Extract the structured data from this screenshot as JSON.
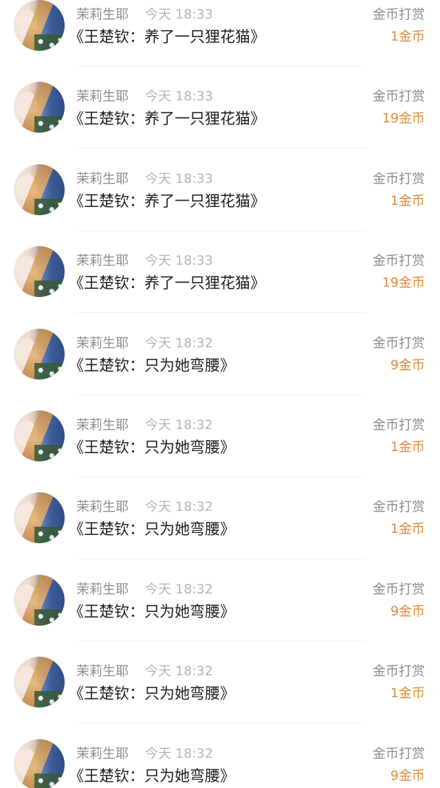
{
  "items": [
    {
      "user": "茉莉生耶",
      "time": "今天 18:33",
      "book": "《王楚钦：养了一只狸花猫》",
      "reward_label": "金币打赏",
      "amount": "1金币"
    },
    {
      "user": "茉莉生耶",
      "time": "今天 18:33",
      "book": "《王楚钦：养了一只狸花猫》",
      "reward_label": "金币打赏",
      "amount": "19金币"
    },
    {
      "user": "茉莉生耶",
      "time": "今天 18:33",
      "book": "《王楚钦：养了一只狸花猫》",
      "reward_label": "金币打赏",
      "amount": "1金币"
    },
    {
      "user": "茉莉生耶",
      "time": "今天 18:33",
      "book": "《王楚钦：养了一只狸花猫》",
      "reward_label": "金币打赏",
      "amount": "19金币"
    },
    {
      "user": "茉莉生耶",
      "time": "今天 18:32",
      "book": "《王楚钦：只为她弯腰》",
      "reward_label": "金币打赏",
      "amount": "9金币"
    },
    {
      "user": "茉莉生耶",
      "time": "今天 18:32",
      "book": "《王楚钦：只为她弯腰》",
      "reward_label": "金币打赏",
      "amount": "1金币"
    },
    {
      "user": "茉莉生耶",
      "time": "今天 18:32",
      "book": "《王楚钦：只为她弯腰》",
      "reward_label": "金币打赏",
      "amount": "1金币"
    },
    {
      "user": "茉莉生耶",
      "time": "今天 18:32",
      "book": "《王楚钦：只为她弯腰》",
      "reward_label": "金币打赏",
      "amount": "9金币"
    },
    {
      "user": "茉莉生耶",
      "time": "今天 18:32",
      "book": "《王楚钦：只为她弯腰》",
      "reward_label": "金币打赏",
      "amount": "1金币"
    },
    {
      "user": "茉莉生耶",
      "time": "今天 18:32",
      "book": "《王楚钦：只为她弯腰》",
      "reward_label": "金币打赏",
      "amount": "9金币"
    }
  ],
  "colors": {
    "amount": "#e08a3c",
    "name": "#8c8c8c",
    "time": "#b4b4b4",
    "book": "#1e1e1e"
  },
  "icons": {
    "avatar": "user-avatar-photo"
  }
}
